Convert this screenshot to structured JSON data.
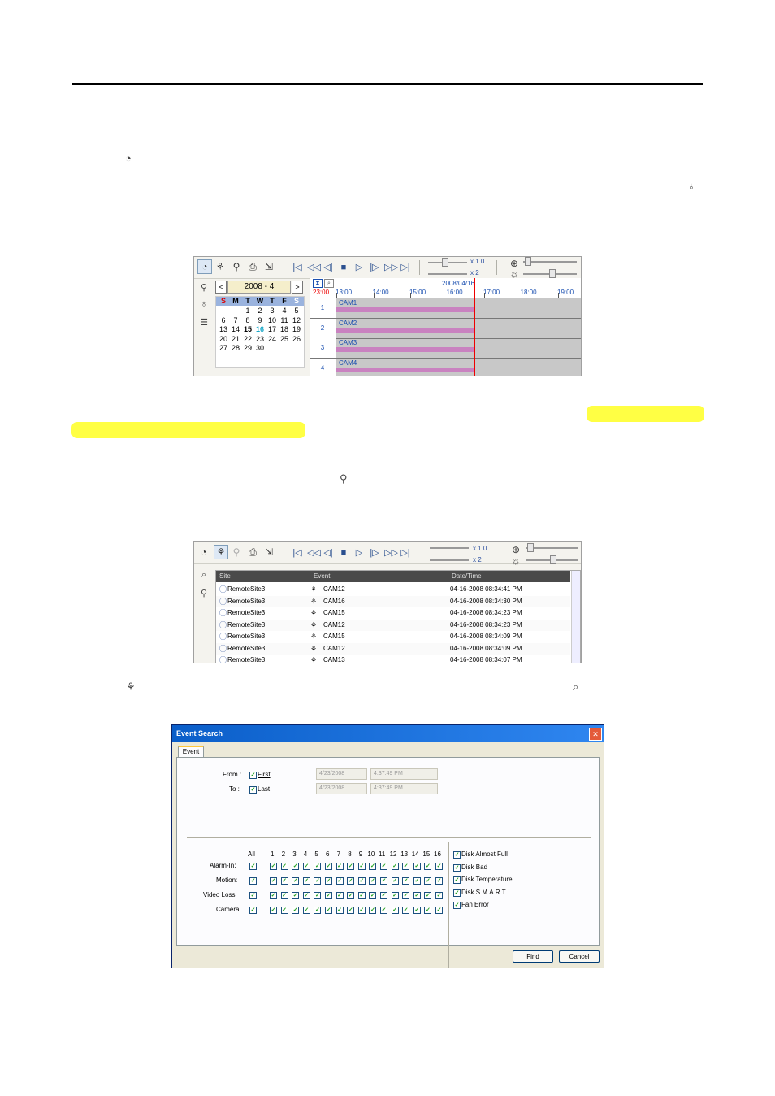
{
  "icons": {
    "inline_1": "search-clock-icon",
    "inline_2": "event-search-icon",
    "inline_3": "record-icon",
    "inline_4": "motion-icon",
    "inline_5": "zoom-icon"
  },
  "timeline_panel": {
    "speed_label": "x 1.0",
    "step_label": "x 2",
    "calendar": {
      "prev": "<",
      "next": ">",
      "month": "2008 - 4",
      "day_headers": [
        "S",
        "M",
        "T",
        "W",
        "T",
        "F",
        "S"
      ],
      "weeks": [
        [
          "",
          "",
          "1",
          "2",
          "3",
          "4",
          "5"
        ],
        [
          "6",
          "7",
          "8",
          "9",
          "10",
          "11",
          "12"
        ],
        [
          "13",
          "14",
          "15",
          "16",
          "17",
          "18",
          "19"
        ],
        [
          "20",
          "21",
          "22",
          "23",
          "24",
          "25",
          "26"
        ],
        [
          "27",
          "28",
          "29",
          "30",
          "",
          "",
          ""
        ]
      ]
    },
    "timeline": {
      "date": "2008/04/16",
      "start": "23:00",
      "hours": [
        "13:00",
        "14:00",
        "15:00",
        "16:00",
        "17:00",
        "18:00",
        "19:00"
      ],
      "rows": [
        {
          "num": "1",
          "label": "CAM1"
        },
        {
          "num": "2",
          "label": "CAM2"
        },
        {
          "num": "3",
          "label": "CAM3"
        },
        {
          "num": "4",
          "label": "CAM4"
        }
      ]
    }
  },
  "event_panel": {
    "speed_label": "x 1.0",
    "step_label": "x 2",
    "columns": [
      "Site",
      "Event",
      "Date/Time"
    ],
    "rows": [
      {
        "site": "RemoteSite3",
        "event": "CAM12",
        "time": "04-16-2008 08:34:41 PM"
      },
      {
        "site": "RemoteSite3",
        "event": "CAM16",
        "time": "04-16-2008 08:34:30 PM"
      },
      {
        "site": "RemoteSite3",
        "event": "CAM15",
        "time": "04-16-2008 08:34:23 PM"
      },
      {
        "site": "RemoteSite3",
        "event": "CAM12",
        "time": "04-16-2008 08:34:23 PM"
      },
      {
        "site": "RemoteSite3",
        "event": "CAM15",
        "time": "04-16-2008 08:34:09 PM"
      },
      {
        "site": "RemoteSite3",
        "event": "CAM12",
        "time": "04-16-2008 08:34:09 PM"
      },
      {
        "site": "RemoteSite3",
        "event": "CAM13",
        "time": "04-16-2008 08:34:07 PM"
      }
    ]
  },
  "dialog": {
    "title": "Event Search",
    "close": "✕",
    "tab": "Event",
    "from_label": "From :",
    "to_label": "To :",
    "first_label": "First",
    "last_label": "Last",
    "from_date": "4/23/2008",
    "from_time": "4:37:49 PM",
    "to_date": "4/23/2008",
    "to_time": "4:37:49 PM",
    "all_label": "All",
    "channels": [
      "1",
      "2",
      "3",
      "4",
      "5",
      "6",
      "7",
      "8",
      "9",
      "10",
      "11",
      "12",
      "13",
      "14",
      "15",
      "16"
    ],
    "event_rows": [
      "Alarm-In:",
      "Motion:",
      "Video Loss:",
      "Camera:"
    ],
    "system_events": [
      "Disk Almost Full",
      "Disk Bad",
      "Disk Temperature",
      "Disk S.M.A.R.T.",
      "Fan Error"
    ],
    "find": "Find",
    "cancel": "Cancel",
    "check": "✓"
  }
}
